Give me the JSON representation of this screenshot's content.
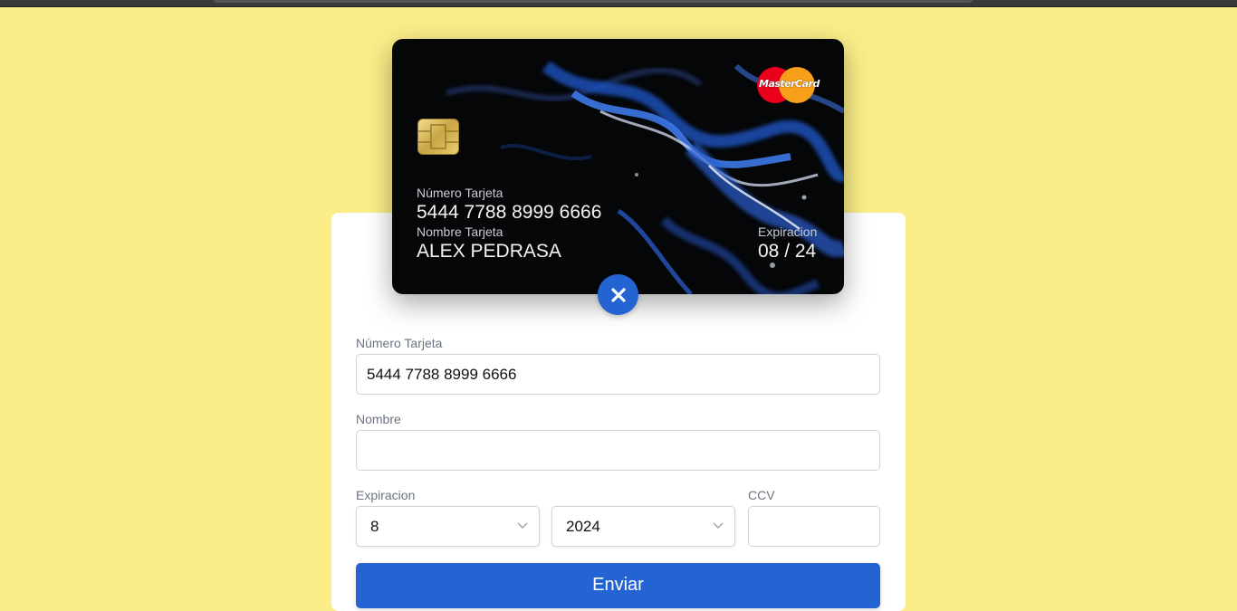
{
  "card": {
    "brand": "MasterCard",
    "number_label": "Número Tarjeta",
    "number": "5444 7788 8999 6666",
    "name_label": "Nombre Tarjeta",
    "name": "ALEX PEDRASA",
    "expiry_label": "Expiracion",
    "expiry": "08 / 24"
  },
  "form": {
    "number_label": "Número Tarjeta",
    "number_value": "5444 7788 8999 6666",
    "name_label": "Nombre",
    "name_value": "",
    "expiry_label": "Expiracion",
    "month_value": "8",
    "year_value": "2024",
    "ccv_label": "CCV",
    "ccv_value": "",
    "submit_label": "Enviar"
  },
  "icons": {
    "close": "close-icon",
    "chevron": "chevron-down-icon",
    "chip": "chip-icon"
  },
  "colors": {
    "background": "#fbee89",
    "accent": "#2364d2",
    "card": "#050608"
  }
}
